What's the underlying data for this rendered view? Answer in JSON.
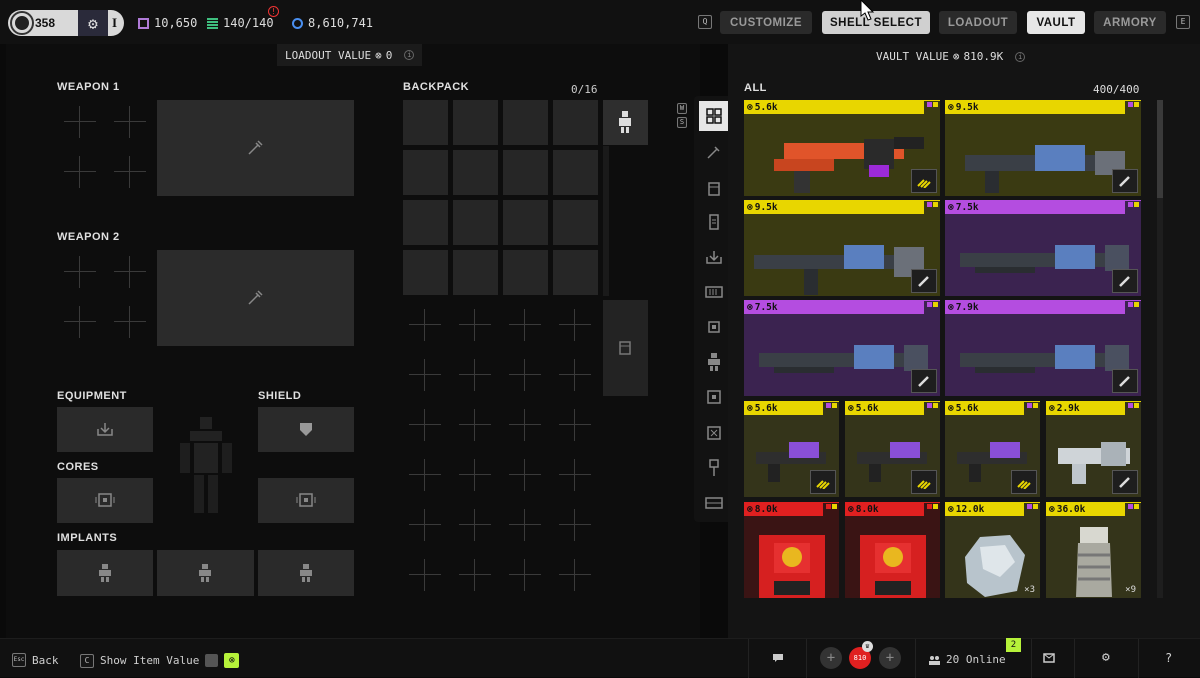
{
  "profile": {
    "level": "358",
    "rank": "I"
  },
  "currencies": [
    {
      "name": "credits",
      "value": "10,650",
      "color": "#b07bd8"
    },
    {
      "name": "stash",
      "value": "140/140",
      "color": "#3fbf7f"
    },
    {
      "name": "aurum",
      "value": "8,610,741",
      "color": "#4a8ff0"
    }
  ],
  "nav": {
    "key_left": "Q",
    "key_right": "E",
    "tabs": [
      "CUSTOMIZE",
      "SHELL SELECT",
      "LOADOUT",
      "VAULT",
      "ARMORY"
    ],
    "active": "VAULT"
  },
  "loadout": {
    "value_label": "LOADOUT VALUE",
    "value": "0",
    "weapon1": "WEAPON 1",
    "weapon2": "WEAPON 2",
    "backpack": "BACKPACK",
    "backpack_count": "0/16",
    "equipment": "EQUIPMENT",
    "shield": "SHIELD",
    "cores": "CORES",
    "implants": "IMPLANTS",
    "key_w": "W",
    "key_s": "S"
  },
  "vault": {
    "value_label": "VAULT VALUE",
    "value": "810.9K",
    "filter": "ALL",
    "count": "400/400",
    "items": [
      {
        "price": "5.6k",
        "band": "#e8d600",
        "bg": "#3a3a12",
        "kind": "rifle-orange",
        "tag": "ammo"
      },
      {
        "price": "9.5k",
        "band": "#e8d600",
        "bg": "#3a3a12",
        "kind": "rifle",
        "tag": "ammo2"
      },
      {
        "price": "9.5k",
        "band": "#e8d600",
        "bg": "#3a3a12",
        "kind": "smg",
        "tag": "ammo2"
      },
      {
        "price": "7.5k",
        "band": "#b44de0",
        "bg": "#3b2350",
        "kind": "shotgun",
        "tag": "ammo2"
      },
      {
        "price": "7.5k",
        "band": "#b44de0",
        "bg": "#3b2350",
        "kind": "shotgun",
        "tag": "ammo2"
      },
      {
        "price": "7.9k",
        "band": "#b44de0",
        "bg": "#3b2350",
        "kind": "shotgun",
        "tag": "ammo2"
      },
      {
        "price": "5.6k",
        "band": "#e8d600",
        "bg": "#34341a",
        "kind": "pistol",
        "tag": "ammo"
      },
      {
        "price": "5.6k",
        "band": "#e8d600",
        "bg": "#34341a",
        "kind": "pistol",
        "tag": "ammo"
      },
      {
        "price": "5.6k",
        "band": "#e8d600",
        "bg": "#34341a",
        "kind": "pistol",
        "tag": "ammo"
      },
      {
        "price": "2.9k",
        "band": "#e8d600",
        "bg": "#34341a",
        "kind": "pistol-white",
        "tag": "ammo2"
      },
      {
        "price": "8.0k",
        "band": "#e02020",
        "bg": "#3a1414",
        "kind": "box",
        "tag": "",
        "count": ""
      },
      {
        "price": "8.0k",
        "band": "#e02020",
        "bg": "#3a1414",
        "kind": "box",
        "tag": "",
        "count": ""
      },
      {
        "price": "12.0k",
        "band": "#e8d600",
        "bg": "#34341a",
        "kind": "crystal",
        "tag": "",
        "count": "×3"
      },
      {
        "price": "36.0k",
        "band": "#e8d600",
        "bg": "#34341a",
        "kind": "grip",
        "tag": "",
        "count": "×9"
      }
    ]
  },
  "bottom": {
    "back_key": "Esc",
    "back": "Back",
    "show_key": "C",
    "show": "Show Item Value",
    "online": "20 Online",
    "online_badge": "2",
    "party_badge": "810"
  }
}
